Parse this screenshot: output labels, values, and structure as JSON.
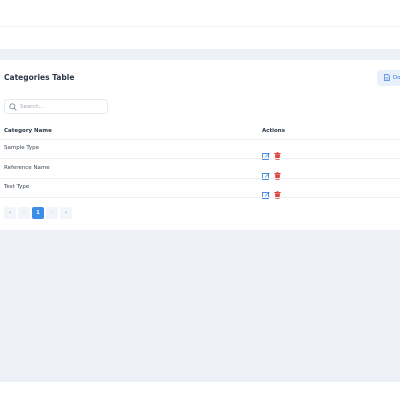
{
  "card": {
    "title": "Categories Table",
    "download_label": "Do"
  },
  "search": {
    "placeholder": "Search...",
    "value": ""
  },
  "table": {
    "columns": [
      "Category Name",
      "Actions"
    ],
    "rows": [
      {
        "name": "Sample Type"
      },
      {
        "name": "Reference Name"
      },
      {
        "name": "Test Type"
      }
    ]
  },
  "pagination": {
    "first": "«",
    "prev": "‹",
    "current": "1",
    "next": "›",
    "last": "»"
  },
  "colors": {
    "edit": "#1e74d9",
    "delete": "#e0443e",
    "active_page": "#3b8ee8",
    "content_bg": "#eef0f7"
  }
}
